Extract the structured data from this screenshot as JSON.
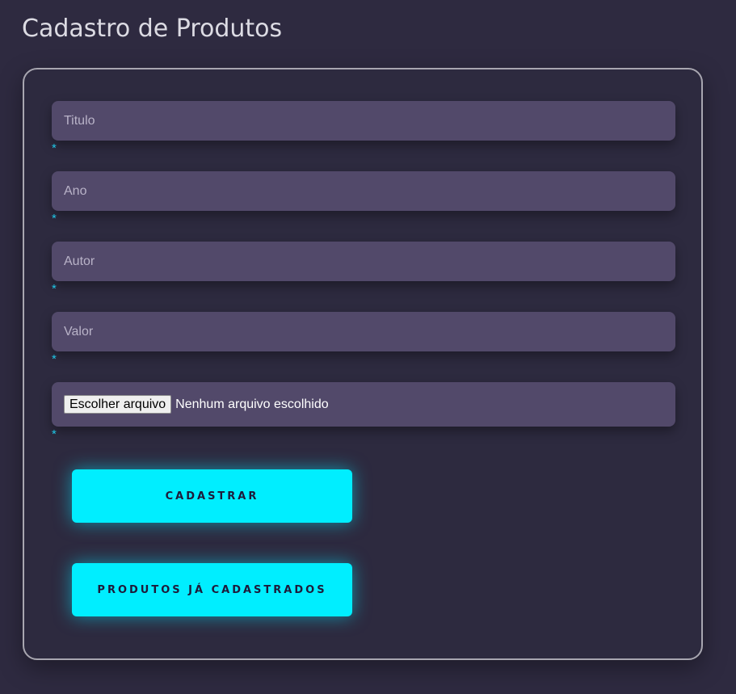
{
  "page": {
    "title": "Cadastro de Produtos"
  },
  "form": {
    "fields": [
      {
        "name": "titulo",
        "placeholder": "Titulo",
        "value": "",
        "required_marker": "*"
      },
      {
        "name": "ano",
        "placeholder": "Ano",
        "value": "",
        "required_marker": "*"
      },
      {
        "name": "autor",
        "placeholder": "Autor",
        "value": "",
        "required_marker": "*"
      },
      {
        "name": "valor",
        "placeholder": "Valor",
        "value": "",
        "required_marker": "*"
      }
    ],
    "file": {
      "button_label": "Escolher arquivo",
      "status": "Nenhum arquivo escolhido",
      "required_marker": "*"
    },
    "submit_label": "CADASTRAR",
    "list_label": "PRODUTOS JÁ CADASTRADOS"
  },
  "colors": {
    "background": "#2e2a40",
    "field": "#52496a",
    "accent": "#00eeff",
    "required": "#1fc6e6",
    "card_border": "#a8a6b0"
  }
}
